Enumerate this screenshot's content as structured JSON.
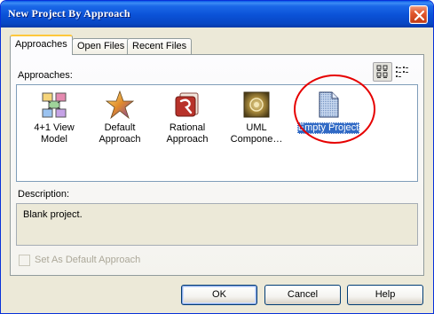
{
  "window": {
    "title": "New Project By Approach"
  },
  "tabs": [
    {
      "label": "Approaches",
      "active": true
    },
    {
      "label": "Open Files",
      "active": false
    },
    {
      "label": "Recent Files",
      "active": false
    }
  ],
  "approaches": {
    "label": "Approaches:",
    "view_modes": [
      "large-icons",
      "list"
    ],
    "selected_view": "large-icons",
    "items": [
      {
        "line1": "4+1 View",
        "line2": "Model",
        "icon": "4plus1-model-icon"
      },
      {
        "line1": "Default",
        "line2": "Approach",
        "icon": "star-icon"
      },
      {
        "line1": "Rational",
        "line2": "Approach",
        "icon": "rational-icon"
      },
      {
        "line1": "UML",
        "line2": "Compone…",
        "icon": "uml-component-icon"
      },
      {
        "line1": "Empty Project",
        "line2": "",
        "icon": "empty-document-icon",
        "selected": true
      }
    ]
  },
  "description": {
    "label": "Description:",
    "text": "Blank project."
  },
  "default_checkbox": {
    "label": "Set As Default Approach",
    "checked": false,
    "disabled": true
  },
  "buttons": {
    "ok": "OK",
    "cancel": "Cancel",
    "help": "Help"
  },
  "colors": {
    "title_bar": "#0a51d6",
    "selection": "#316ac5",
    "highlight_circle": "#e60000",
    "dialog_bg": "#ece9d8"
  }
}
